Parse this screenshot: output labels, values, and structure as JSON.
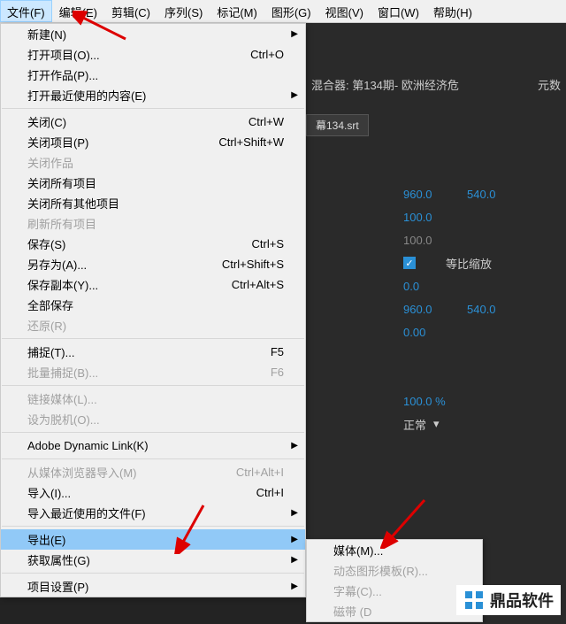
{
  "menubar": {
    "items": [
      {
        "label": "文件(F)",
        "active": true
      },
      {
        "label": "编辑(E)"
      },
      {
        "label": "剪辑(C)"
      },
      {
        "label": "序列(S)"
      },
      {
        "label": "标记(M)"
      },
      {
        "label": "图形(G)"
      },
      {
        "label": "视图(V)"
      },
      {
        "label": "窗口(W)"
      },
      {
        "label": "帮助(H)"
      }
    ]
  },
  "dropdown": {
    "items": [
      {
        "label": "新建(N)",
        "arrow": true
      },
      {
        "label": "打开项目(O)...",
        "shortcut": "Ctrl+O"
      },
      {
        "label": "打开作品(P)..."
      },
      {
        "label": "打开最近使用的内容(E)",
        "arrow": true
      },
      {
        "sep": true
      },
      {
        "label": "关闭(C)",
        "shortcut": "Ctrl+W"
      },
      {
        "label": "关闭项目(P)",
        "shortcut": "Ctrl+Shift+W"
      },
      {
        "label": "关闭作品",
        "disabled": true
      },
      {
        "label": "关闭所有项目"
      },
      {
        "label": "关闭所有其他项目"
      },
      {
        "label": "刷新所有项目",
        "disabled": true
      },
      {
        "label": "保存(S)",
        "shortcut": "Ctrl+S"
      },
      {
        "label": "另存为(A)...",
        "shortcut": "Ctrl+Shift+S"
      },
      {
        "label": "保存副本(Y)...",
        "shortcut": "Ctrl+Alt+S"
      },
      {
        "label": "全部保存"
      },
      {
        "label": "还原(R)",
        "disabled": true
      },
      {
        "sep": true
      },
      {
        "label": "捕捉(T)...",
        "shortcut": "F5"
      },
      {
        "label": "批量捕捉(B)...",
        "shortcut": "F6",
        "disabled": true
      },
      {
        "sep": true
      },
      {
        "label": "链接媒体(L)...",
        "disabled": true
      },
      {
        "label": "设为脱机(O)...",
        "disabled": true
      },
      {
        "sep": true
      },
      {
        "label": "Adobe Dynamic Link(K)",
        "arrow": true
      },
      {
        "sep": true
      },
      {
        "label": "从媒体浏览器导入(M)",
        "shortcut": "Ctrl+Alt+I",
        "disabled": true
      },
      {
        "label": "导入(I)...",
        "shortcut": "Ctrl+I"
      },
      {
        "label": "导入最近使用的文件(F)",
        "arrow": true
      },
      {
        "sep": true
      },
      {
        "label": "导出(E)",
        "arrow": true,
        "highlighted": true
      },
      {
        "label": "获取属性(G)",
        "arrow": true
      },
      {
        "sep": true
      },
      {
        "label": "项目设置(P)",
        "arrow": true
      }
    ]
  },
  "submenu": {
    "items": [
      {
        "label": "媒体(M)..."
      },
      {
        "label": "动态图形模板(R)...",
        "disabled": true
      },
      {
        "label": "字幕(C)...",
        "disabled": true
      },
      {
        "label": "磁带 (D",
        "disabled": true
      }
    ]
  },
  "bgpanel": {
    "header": "混合器: 第134期- 欧洲经济危",
    "header_right": "元数",
    "tab": "幕134.srt",
    "rows": [
      {
        "v1": "960.0",
        "v2": "540.0"
      },
      {
        "v1": "100.0"
      },
      {
        "v1": "100.0",
        "dim": true
      },
      {
        "checkbox": true,
        "cblabel": "等比缩放"
      },
      {
        "v1": "0.0"
      },
      {
        "v1": "960.0",
        "v2": "540.0"
      },
      {
        "v1": "0.00"
      }
    ],
    "percent": "100.0 %",
    "blendmode": "正常"
  },
  "watermark": {
    "text": "鼎品软件"
  }
}
